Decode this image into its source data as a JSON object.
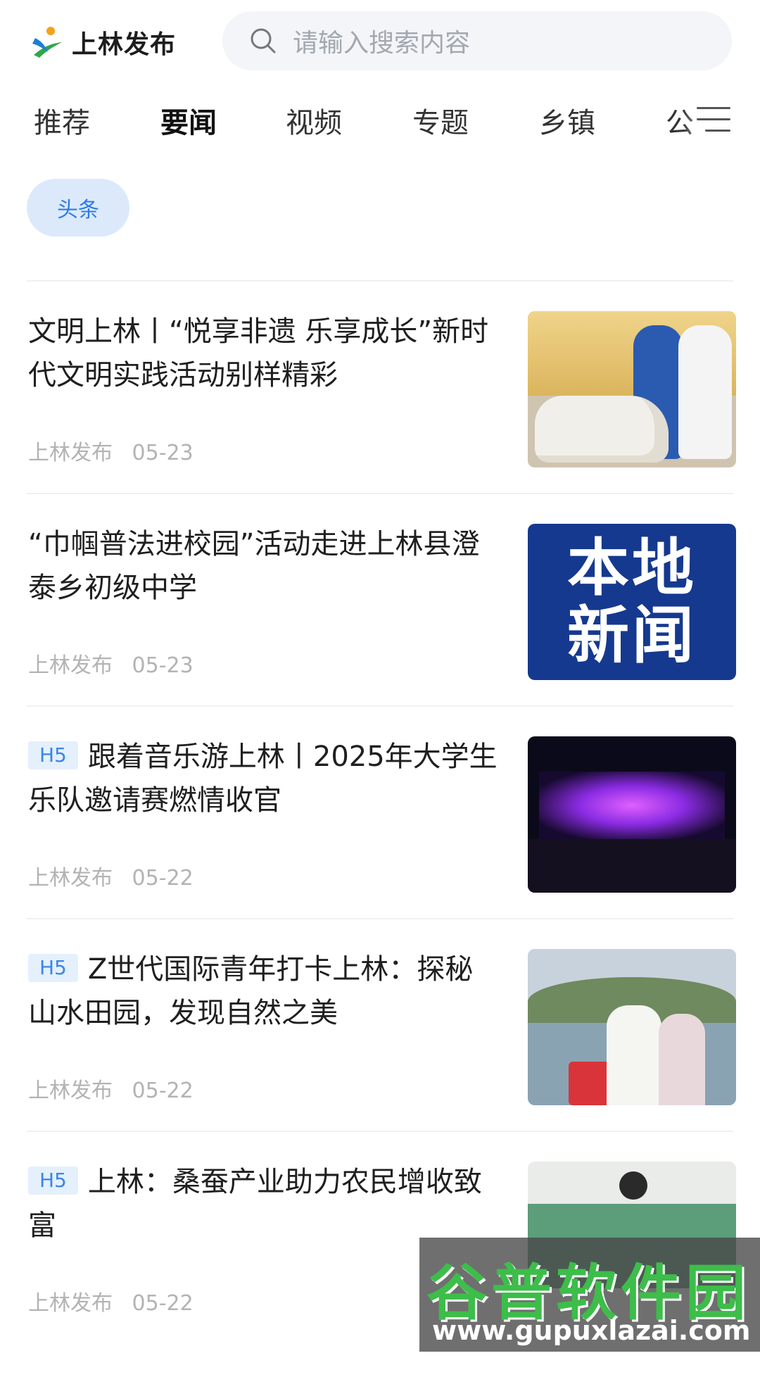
{
  "header": {
    "logo_text": "上林发布",
    "search_placeholder": "请输入搜索内容"
  },
  "tabs": [
    {
      "label": "推荐",
      "active": false
    },
    {
      "label": "要闻",
      "active": true
    },
    {
      "label": "视频",
      "active": false
    },
    {
      "label": "专题",
      "active": false
    },
    {
      "label": "乡镇",
      "active": false
    },
    {
      "label": "公",
      "active": false
    }
  ],
  "chip": {
    "label": "头条"
  },
  "news": [
    {
      "badge": "",
      "title": "文明上林丨“悦享非遗 乐享成长”新时代文明实践活动别样精彩",
      "source": "上林发布",
      "date": "05-23",
      "thumb": "children-with-pony-photo"
    },
    {
      "badge": "",
      "title": "“巾帼普法进校园”活动走进上林县澄泰乡初级中学",
      "source": "上林发布",
      "date": "05-23",
      "thumb_text": [
        "本地",
        "新闻"
      ]
    },
    {
      "badge": "H5",
      "title": "跟着音乐游上林丨2025年大学生乐队邀请赛燃情收官",
      "source": "上林发布",
      "date": "05-22",
      "thumb": "concert-stage-photo"
    },
    {
      "badge": "H5",
      "title": "Z世代国际青年打卡上林：探秘山水田园，发现自然之美",
      "source": "上林发布",
      "date": "05-22",
      "thumb": "youth-on-boat-photo"
    },
    {
      "badge": "H5",
      "title": "上林：桑蚕产业助力农民增收致富",
      "source": "上林发布",
      "date": "05-22",
      "thumb": "silkworm-farm-photo"
    }
  ],
  "watermark": {
    "title": "谷普软件园",
    "url": "www.gupuxlazai.com"
  },
  "colors": {
    "accent": "#2f7ae5",
    "chip_bg": "#dbe9fb",
    "badge_bg": "#e5f0fd",
    "meta_text": "#b3b3b3"
  }
}
